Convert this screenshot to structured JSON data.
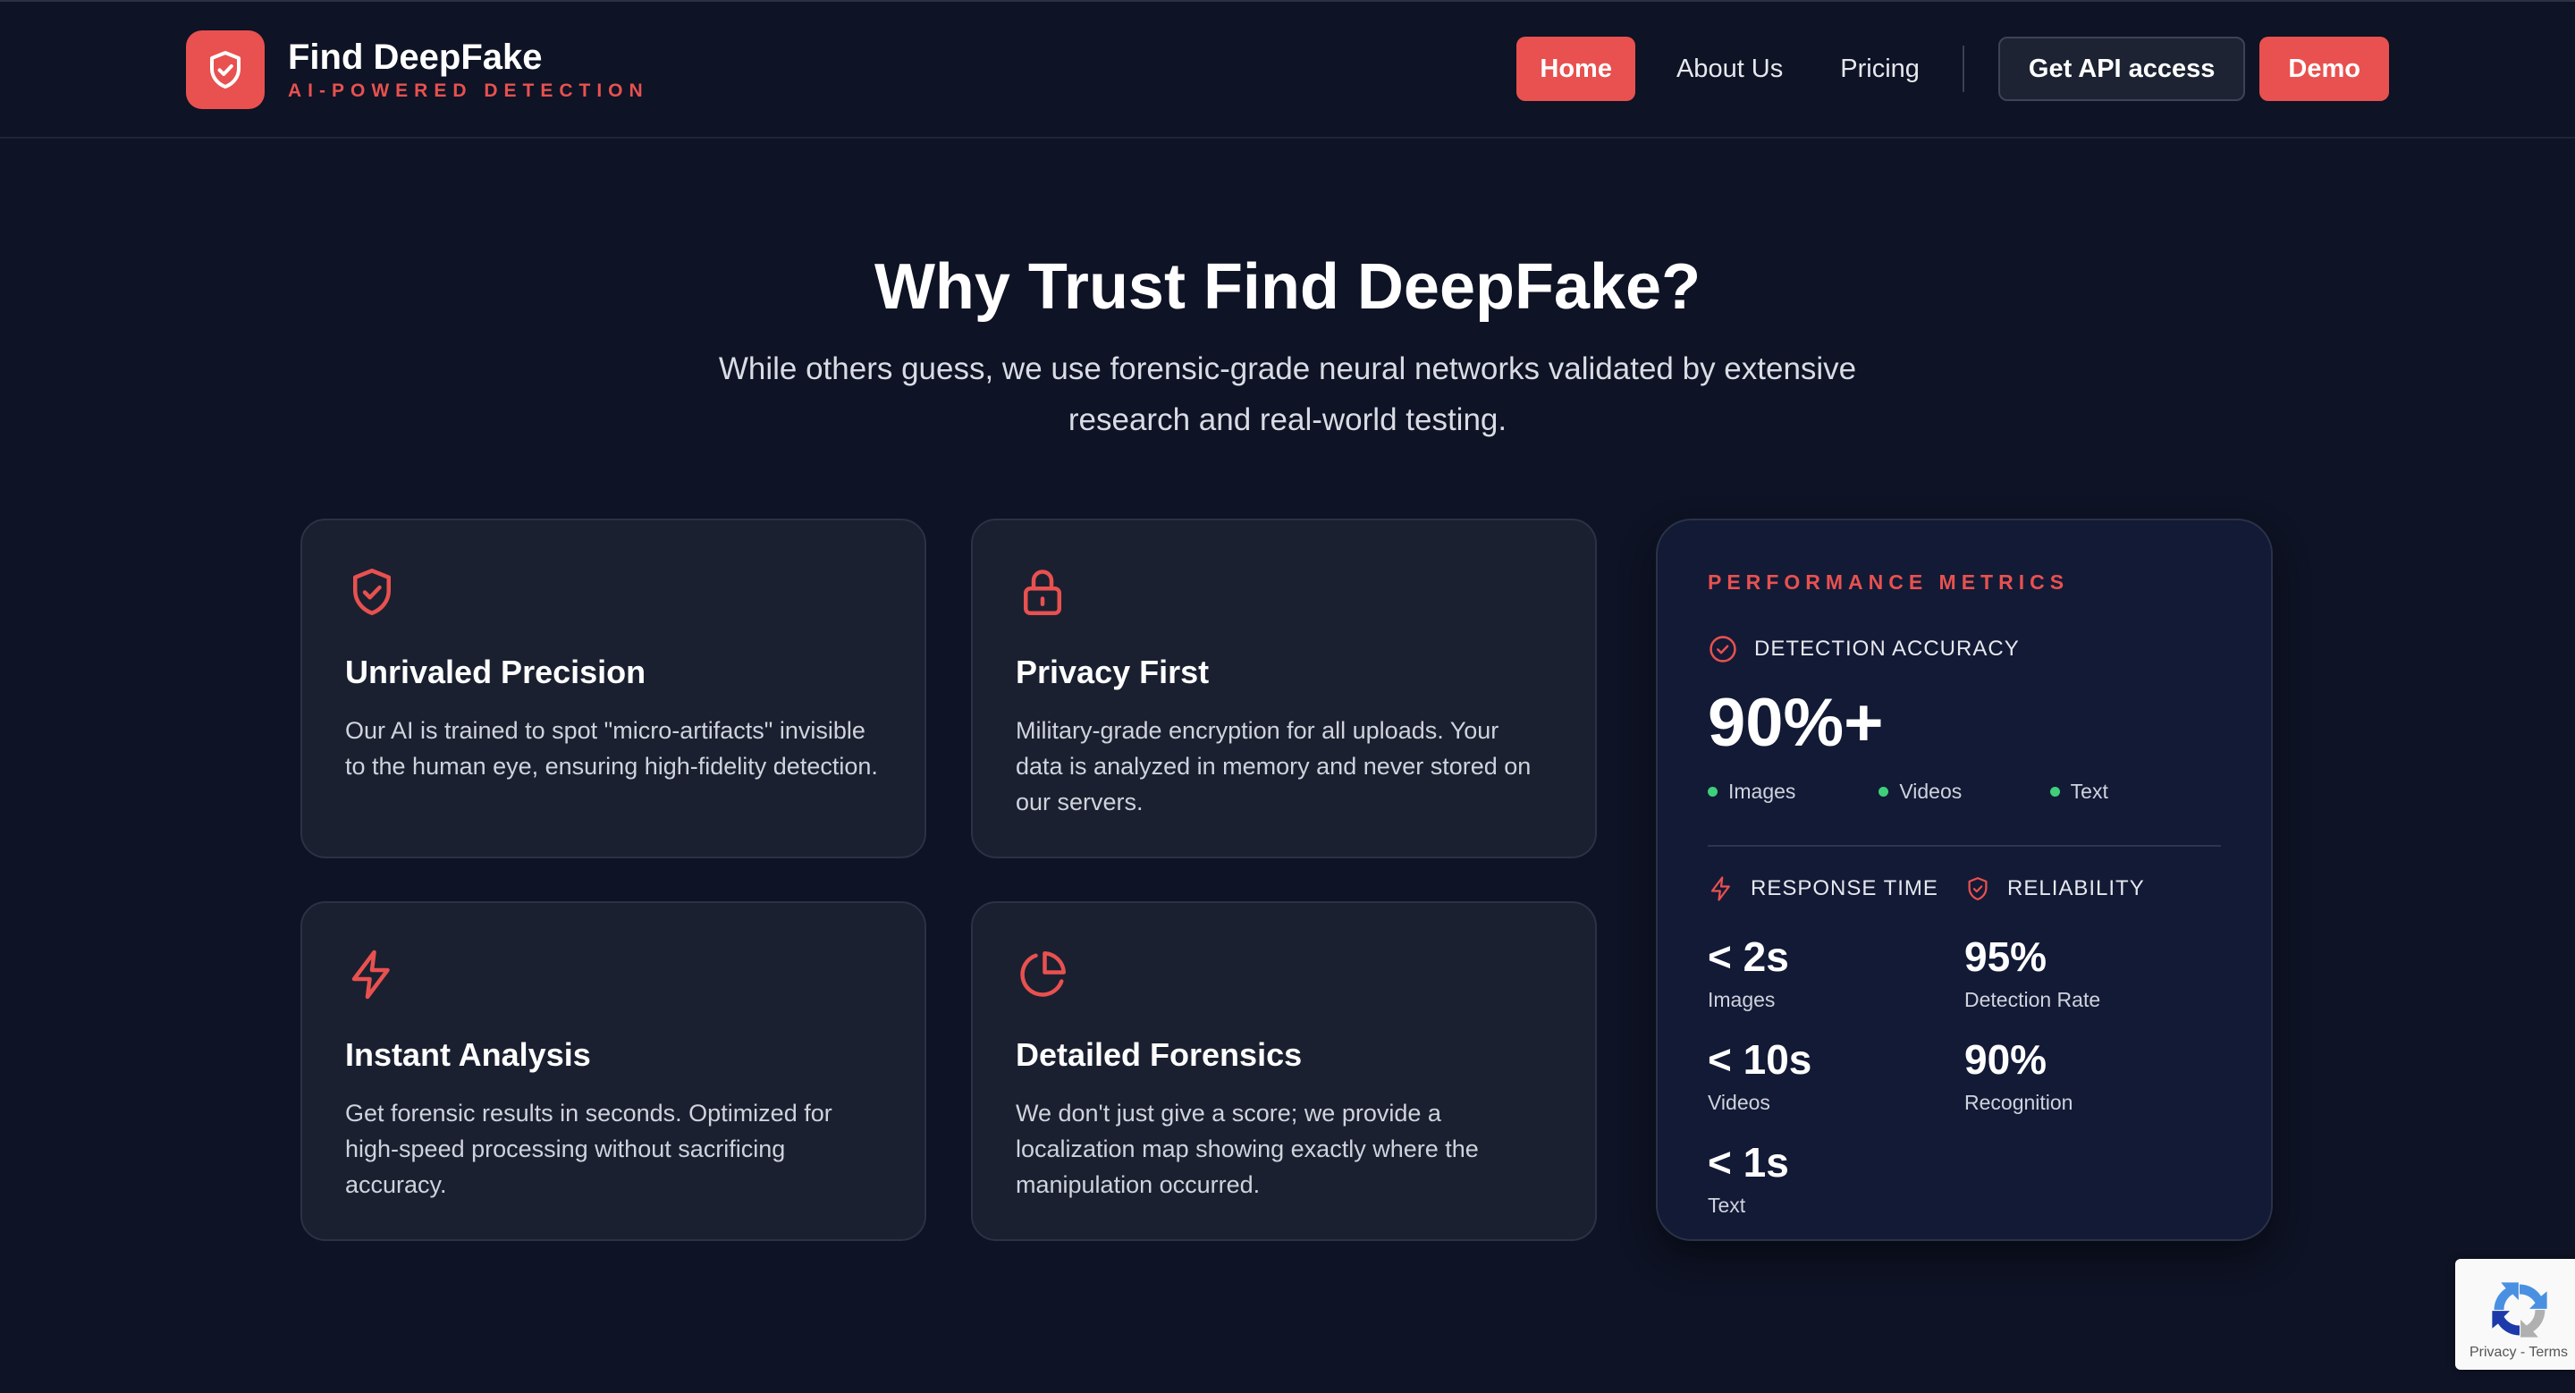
{
  "header": {
    "brand_title": "Find DeepFake",
    "brand_subtitle": "AI-POWERED DETECTION",
    "logo_icon": "shield-check-icon",
    "nav": {
      "home": "Home",
      "about": "About Us",
      "pricing": "Pricing",
      "api": "Get API access",
      "demo": "Demo"
    }
  },
  "hero": {
    "title": "Why Trust Find DeepFake?",
    "subtitle": "While others guess, we use forensic-grade neural networks validated by extensive research and real-world testing."
  },
  "features": [
    {
      "icon": "shield-check-icon",
      "title": "Unrivaled Precision",
      "text": "Our AI is trained to spot \"micro-artifacts\" invisible to the human eye, ensuring high-fidelity detection."
    },
    {
      "icon": "lock-icon",
      "title": "Privacy First",
      "text": "Military-grade encryption for all uploads. Your data is analyzed in memory and never stored on our servers."
    },
    {
      "icon": "lightning-icon",
      "title": "Instant Analysis",
      "text": "Get forensic results in seconds. Optimized for high-speed processing without sacrificing accuracy."
    },
    {
      "icon": "pie-chart-icon",
      "title": "Detailed Forensics",
      "text": "We don't just give a score; we provide a localization map showing exactly where the manipulation occurred."
    }
  ],
  "metrics": {
    "heading": "PERFORMANCE METRICS",
    "accuracy_label": "DETECTION ACCURACY",
    "accuracy_value": "90%+",
    "tags": [
      "Images",
      "Videos",
      "Text"
    ],
    "response_label": "RESPONSE TIME",
    "response": [
      {
        "value": "< 2s",
        "caption": "Images"
      },
      {
        "value": "< 10s",
        "caption": "Videos"
      },
      {
        "value": "< 1s",
        "caption": "Text"
      }
    ],
    "reliability_label": "RELIABILITY",
    "reliability": [
      {
        "value": "95%",
        "caption": "Detection Rate"
      },
      {
        "value": "90%",
        "caption": "Recognition"
      }
    ]
  },
  "recaptcha": {
    "text": "Privacy - Terms"
  },
  "colors": {
    "accent": "#e8514f",
    "background": "#0e1325",
    "card": "#1a2030",
    "status_dot": "#3ecf7a"
  }
}
